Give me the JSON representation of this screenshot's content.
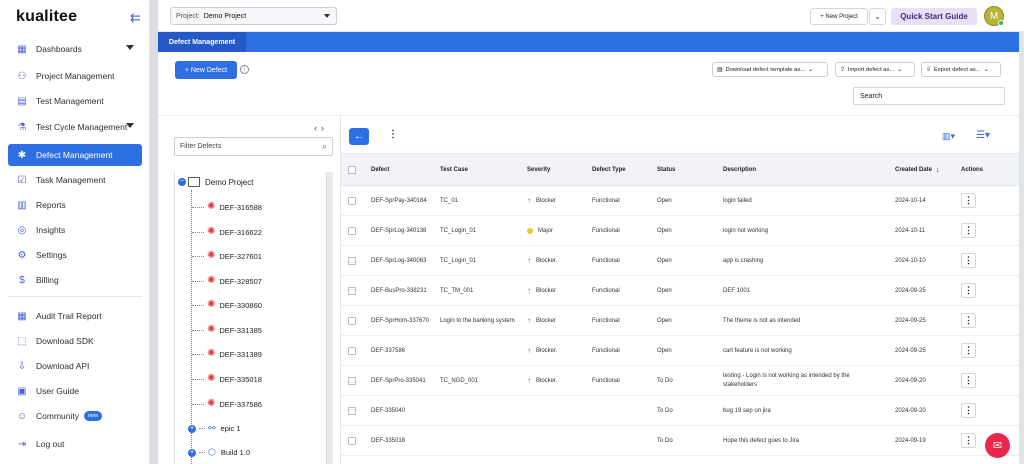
{
  "brand": {
    "logo": "kualitee"
  },
  "sidebar": {
    "items": [
      {
        "label": "Dashboards",
        "icon": "dashboard-icon"
      },
      {
        "label": "Project Management",
        "icon": "project-icon"
      },
      {
        "label": "Test Management",
        "icon": "test-icon"
      },
      {
        "label": "Test Cycle Management",
        "icon": "cycle-icon"
      },
      {
        "label": "Defect Management",
        "icon": "bug-icon",
        "active": true
      },
      {
        "label": "Task Management",
        "icon": "task-icon"
      },
      {
        "label": "Reports",
        "icon": "reports-icon"
      },
      {
        "label": "Insights",
        "icon": "insights-icon"
      },
      {
        "label": "Settings",
        "icon": "gear-icon"
      },
      {
        "label": "Billing",
        "icon": "billing-icon"
      },
      {
        "label": "Audit Trail Report",
        "icon": "audit-icon"
      },
      {
        "label": "Download SDK",
        "icon": "sdk-icon"
      },
      {
        "label": "Download API",
        "icon": "api-icon"
      },
      {
        "label": "User Guide",
        "icon": "guide-icon"
      },
      {
        "label": "Community",
        "icon": "community-icon",
        "badge": "new"
      },
      {
        "label": "Log out",
        "icon": "logout-icon"
      }
    ]
  },
  "topbar": {
    "project_label": "Project:",
    "project_value": "Demo Project",
    "new_project": "+ New Project",
    "quick_start": "Quick Start Guide",
    "avatar_initial": "M"
  },
  "tabs": [
    {
      "label": "Defect Management"
    }
  ],
  "toolbar": {
    "new_defect": "+ New Defect",
    "download_template": "Download defect template as...",
    "import": "Import defect as...",
    "export": "Export defect as...",
    "search_placeholder": "Search"
  },
  "tree": {
    "filter_placeholder": "Filter Defects",
    "root": "Demo Project",
    "defects": [
      "DEF-316588",
      "DEF-316622",
      "DEF-327601",
      "DEF-328507",
      "DEF-330860",
      "DEF-331385",
      "DEF-331389",
      "DEF-335018",
      "DEF-337586"
    ],
    "groups": [
      "epic 1",
      "Build 1.0"
    ]
  },
  "table": {
    "columns": [
      "Defect",
      "Test Case",
      "Severity",
      "Defect Type",
      "Status",
      "Description",
      "Created Date",
      "Actions"
    ],
    "rows": [
      {
        "defect": "DEF-SprPay-340184",
        "test_case": "TC_01",
        "severity": "Blocker",
        "type": "Functional",
        "status": "Open",
        "description": "login failed",
        "created": "2024-10-14"
      },
      {
        "defect": "DEF-SprLog-340138",
        "test_case": "TC_Login_01",
        "severity": "Major",
        "type": "Functional",
        "status": "Open",
        "description": "login not working",
        "created": "2024-10-11"
      },
      {
        "defect": "DEF-SprLog-340063",
        "test_case": "TC_Login_01",
        "severity": "Blocker.",
        "type": "Functional",
        "status": "Open",
        "description": "app is crashing",
        "created": "2024-10-10"
      },
      {
        "defect": "DEF-BusPro-338231",
        "test_case": "TC_TM_001",
        "severity": "Blocker",
        "type": "Functional",
        "status": "Open",
        "description": "DEF 1001",
        "created": "2024-09-25"
      },
      {
        "defect": "DEF-SprHom-337670",
        "test_case": "Login to the banking system",
        "severity": "Blocker",
        "type": "Functional",
        "status": "Open",
        "description": "The theme is not as intended",
        "created": "2024-09-25"
      },
      {
        "defect": "DEF-337586",
        "test_case": "",
        "severity": "Blocker.",
        "type": "Functional",
        "status": "Open",
        "description": "cart feature is not working",
        "created": "2024-09-25"
      },
      {
        "defect": "DEF-SprPro-335041",
        "test_case": "TC_NGD_001",
        "severity": "Blocker.",
        "type": "Functional",
        "status": "To Do",
        "description": "testing - Login is not working as intended by the stakeholders",
        "created": "2024-09-20"
      },
      {
        "defect": "DEF-335040",
        "test_case": "",
        "severity": "",
        "type": "",
        "status": "To Do",
        "description": "bug 19 sep on jira",
        "created": "2024-09-20"
      },
      {
        "defect": "DEF-335018",
        "test_case": "",
        "severity": "",
        "type": "",
        "status": "To Do",
        "description": "Hope this defect goes to Jira",
        "created": "2024-09-19"
      }
    ]
  },
  "colors": {
    "accent": "#2f6fe4",
    "blocker": "#e23b3b",
    "major": "#f1c232",
    "chat": "#e8284c"
  }
}
